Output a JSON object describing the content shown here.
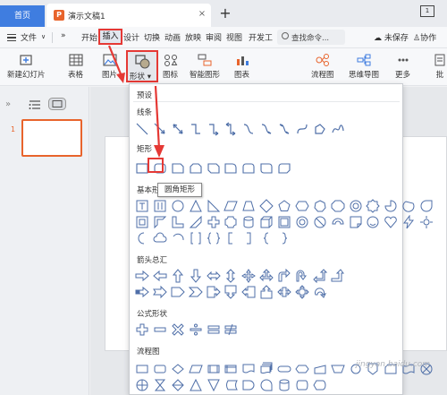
{
  "tabs": {
    "home": "首页",
    "doc_icon": "P",
    "doc_title": "演示文稿1",
    "close": "×",
    "add": "+",
    "window_badge": "1"
  },
  "menu": {
    "file": "文件",
    "file_caret": "∨",
    "more": "»",
    "items": [
      "开始",
      "插入",
      "设计",
      "切换",
      "动画",
      "放映",
      "审阅",
      "视图",
      "开发工"
    ],
    "search": "查找命令...",
    "unsaved": "未保存",
    "collab": "协作"
  },
  "ribbon": {
    "new_slide": "新建幻灯片",
    "table": "表格",
    "picture": "图片",
    "shape": "形状",
    "icon": "图标",
    "smart": "智能图形",
    "chart": "图表",
    "flowchart": "流程图",
    "mindmap": "思维导图",
    "more": "更多",
    "right_edge": "批"
  },
  "dropdown": {
    "preset": "预设",
    "lines": "线条",
    "rect": "矩形",
    "basic": "基本形",
    "arrows": "箭头总汇",
    "formula": "公式形状",
    "flow": "流程图"
  },
  "tooltip": "圆角矩形",
  "slide_number": "1",
  "watermark": "jingyan.baidu.com",
  "accent": "#3f7de0",
  "highlight": "#e53935",
  "orange": "#e8642c"
}
